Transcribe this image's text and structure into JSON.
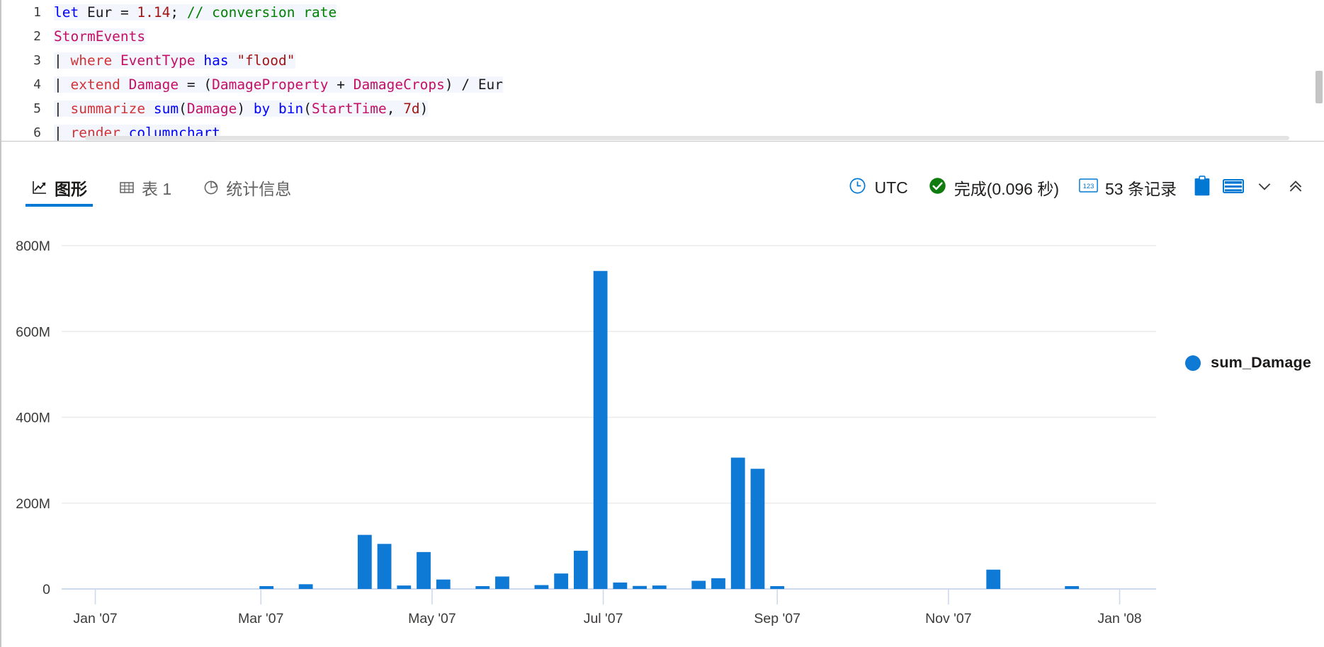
{
  "editor": {
    "lines": [
      {
        "num": "1",
        "tokens": [
          {
            "t": "let ",
            "c": "kw"
          },
          {
            "t": "Eur ",
            "c": "plain"
          },
          {
            "t": "= ",
            "c": "op"
          },
          {
            "t": "1.14",
            "c": "num"
          },
          {
            "t": "; ",
            "c": "plain"
          },
          {
            "t": "// conversion rate",
            "c": "cmt"
          }
        ]
      },
      {
        "num": "2",
        "tokens": [
          {
            "t": "StormEvents",
            "c": "tbl"
          }
        ]
      },
      {
        "num": "3",
        "tokens": [
          {
            "t": "| ",
            "c": "pipe"
          },
          {
            "t": "where ",
            "c": "cmd"
          },
          {
            "t": "EventType ",
            "c": "tbl"
          },
          {
            "t": "has ",
            "c": "kw"
          },
          {
            "t": "\"flood\"",
            "c": "str"
          }
        ]
      },
      {
        "num": "4",
        "tokens": [
          {
            "t": "| ",
            "c": "pipe"
          },
          {
            "t": "extend ",
            "c": "cmd"
          },
          {
            "t": "Damage ",
            "c": "tbl"
          },
          {
            "t": "= ",
            "c": "op"
          },
          {
            "t": "(",
            "c": "plain"
          },
          {
            "t": "DamageProperty",
            "c": "tbl"
          },
          {
            "t": " + ",
            "c": "op"
          },
          {
            "t": "DamageCrops",
            "c": "tbl"
          },
          {
            "t": ") ",
            "c": "plain"
          },
          {
            "t": "/ ",
            "c": "op"
          },
          {
            "t": "Eur",
            "c": "plain"
          }
        ]
      },
      {
        "num": "5",
        "tokens": [
          {
            "t": "| ",
            "c": "pipe"
          },
          {
            "t": "summarize ",
            "c": "cmd"
          },
          {
            "t": "sum",
            "c": "fn"
          },
          {
            "t": "(",
            "c": "plain"
          },
          {
            "t": "Damage",
            "c": "tbl"
          },
          {
            "t": ") ",
            "c": "plain"
          },
          {
            "t": "by ",
            "c": "kw"
          },
          {
            "t": "bin",
            "c": "fn"
          },
          {
            "t": "(",
            "c": "plain"
          },
          {
            "t": "StartTime",
            "c": "tbl"
          },
          {
            "t": ", ",
            "c": "plain"
          },
          {
            "t": "7d",
            "c": "num"
          },
          {
            "t": ")",
            "c": "plain"
          }
        ]
      },
      {
        "num": "6",
        "tokens": [
          {
            "t": "| ",
            "c": "pipe"
          },
          {
            "t": "render ",
            "c": "cmd"
          },
          {
            "t": "columnchart",
            "c": "fn"
          }
        ]
      }
    ]
  },
  "toolbar": {
    "tabs": [
      {
        "label": "图形",
        "icon": "line-chart-icon",
        "active": true
      },
      {
        "label": "表 1",
        "icon": "table-icon",
        "active": false
      },
      {
        "label": "统计信息",
        "icon": "pie-chart-icon",
        "active": false
      }
    ],
    "status": {
      "timezone": "UTC",
      "timezone_icon": "clock-icon",
      "completion": "完成(0.096 秒)",
      "completion_icon": "check-circle-icon",
      "records": "53 条记录",
      "records_icon": "numbers-123-icon",
      "copy_icon": "clipboard-icon",
      "layout_icon": "layout-rows-icon",
      "chevron_down_icon": "chevron-down-icon",
      "collapse_icon": "double-chevron-up-icon"
    }
  },
  "chart_data": {
    "type": "bar",
    "title": "",
    "xlabel": "",
    "ylabel": "",
    "ylim": [
      0,
      800000000
    ],
    "grid": true,
    "legend_position": "right",
    "legend": [
      "sum_Damage"
    ],
    "series_color": "#0f7ad6",
    "y_ticks": [
      {
        "label": "800M",
        "value": 800000000
      },
      {
        "label": "600M",
        "value": 600000000
      },
      {
        "label": "400M",
        "value": 400000000
      },
      {
        "label": "200M",
        "value": 200000000
      },
      {
        "label": "0",
        "value": 0
      }
    ],
    "x_ticks": [
      {
        "label": "Jan '07",
        "x": 0
      },
      {
        "label": "Mar '07",
        "x": 59
      },
      {
        "label": "May '07",
        "x": 120
      },
      {
        "label": "Jul '07",
        "x": 181
      },
      {
        "label": "Sep '07",
        "x": 243
      },
      {
        "label": "Nov '07",
        "x": 304
      },
      {
        "label": "Jan '08",
        "x": 365
      }
    ],
    "x_domain_days": [
      -12,
      378
    ],
    "bar_width_days": 5.0,
    "points": [
      {
        "x": 61,
        "date": "2007-03-05",
        "y": 5000000
      },
      {
        "x": 75,
        "date": "2007-03-19",
        "y": 11000000
      },
      {
        "x": 96,
        "date": "2007-04-09",
        "y": 126000000
      },
      {
        "x": 103,
        "date": "2007-04-16",
        "y": 105000000
      },
      {
        "x": 110,
        "date": "2007-04-23",
        "y": 8000000
      },
      {
        "x": 117,
        "date": "2007-04-30",
        "y": 86000000
      },
      {
        "x": 124,
        "date": "2007-05-07",
        "y": 22000000
      },
      {
        "x": 138,
        "date": "2007-05-21",
        "y": 4000000
      },
      {
        "x": 145,
        "date": "2007-05-28",
        "y": 29000000
      },
      {
        "x": 159,
        "date": "2007-06-11",
        "y": 9000000
      },
      {
        "x": 166,
        "date": "2007-06-18",
        "y": 36000000
      },
      {
        "x": 173,
        "date": "2007-06-25",
        "y": 89000000
      },
      {
        "x": 180,
        "date": "2007-07-02",
        "y": 741000000
      },
      {
        "x": 187,
        "date": "2007-07-09",
        "y": 15000000
      },
      {
        "x": 194,
        "date": "2007-07-16",
        "y": 7000000
      },
      {
        "x": 201,
        "date": "2007-07-23",
        "y": 8000000
      },
      {
        "x": 215,
        "date": "2007-08-06",
        "y": 19000000
      },
      {
        "x": 222,
        "date": "2007-08-13",
        "y": 25000000
      },
      {
        "x": 229,
        "date": "2007-08-20",
        "y": 306000000
      },
      {
        "x": 236,
        "date": "2007-08-27",
        "y": 280000000
      },
      {
        "x": 243,
        "date": "2007-09-03",
        "y": 5000000
      },
      {
        "x": 320,
        "date": "2007-11-19",
        "y": 45000000
      },
      {
        "x": 348,
        "date": "2007-12-17",
        "y": 4000000
      }
    ]
  }
}
